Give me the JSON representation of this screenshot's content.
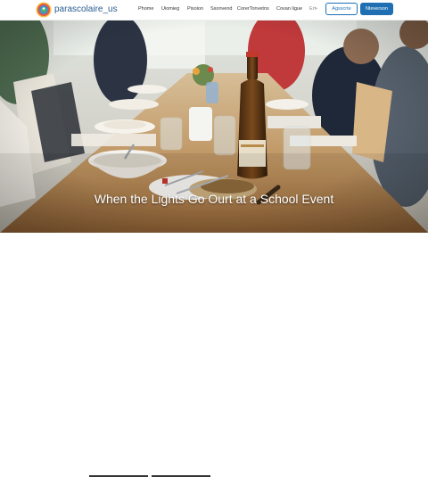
{
  "site": {
    "name": "parascolaire_us"
  },
  "nav": {
    "items": [
      "Phome",
      "Uiomieg",
      "Pisoion",
      "Ssonvend",
      "CorerTonvetns",
      "Covan ligue",
      "Ert•"
    ]
  },
  "header_buttons": {
    "outline_label": "Agsscrte",
    "solid_label": "Nteverson"
  },
  "hero": {
    "title": "When the Lights Go Ourt at a School Event"
  },
  "colors": {
    "brand_blue": "#1f6fb2",
    "site_name": "#2a5d8f",
    "hero_text": "#ffffff"
  }
}
